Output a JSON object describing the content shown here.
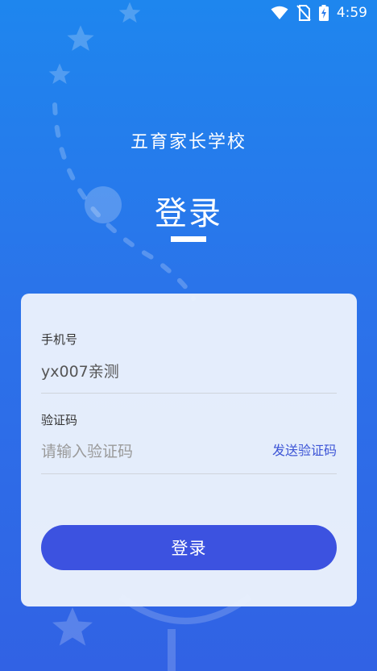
{
  "status_bar": {
    "time": "4:59",
    "icons": [
      "wifi-icon",
      "no-sim-icon",
      "battery-charging-icon"
    ]
  },
  "header": {
    "school_name": "五育家长学校",
    "title": "登录"
  },
  "form": {
    "phone": {
      "label": "手机号",
      "value": "yx007亲测"
    },
    "code": {
      "label": "验证码",
      "placeholder": "请输入验证码",
      "send_label": "发送验证码"
    },
    "submit_label": "登录"
  },
  "colors": {
    "background_top": "#1e86ee",
    "background_bottom": "#3162e4",
    "button": "#3c52e0",
    "link": "#3d55d6"
  }
}
